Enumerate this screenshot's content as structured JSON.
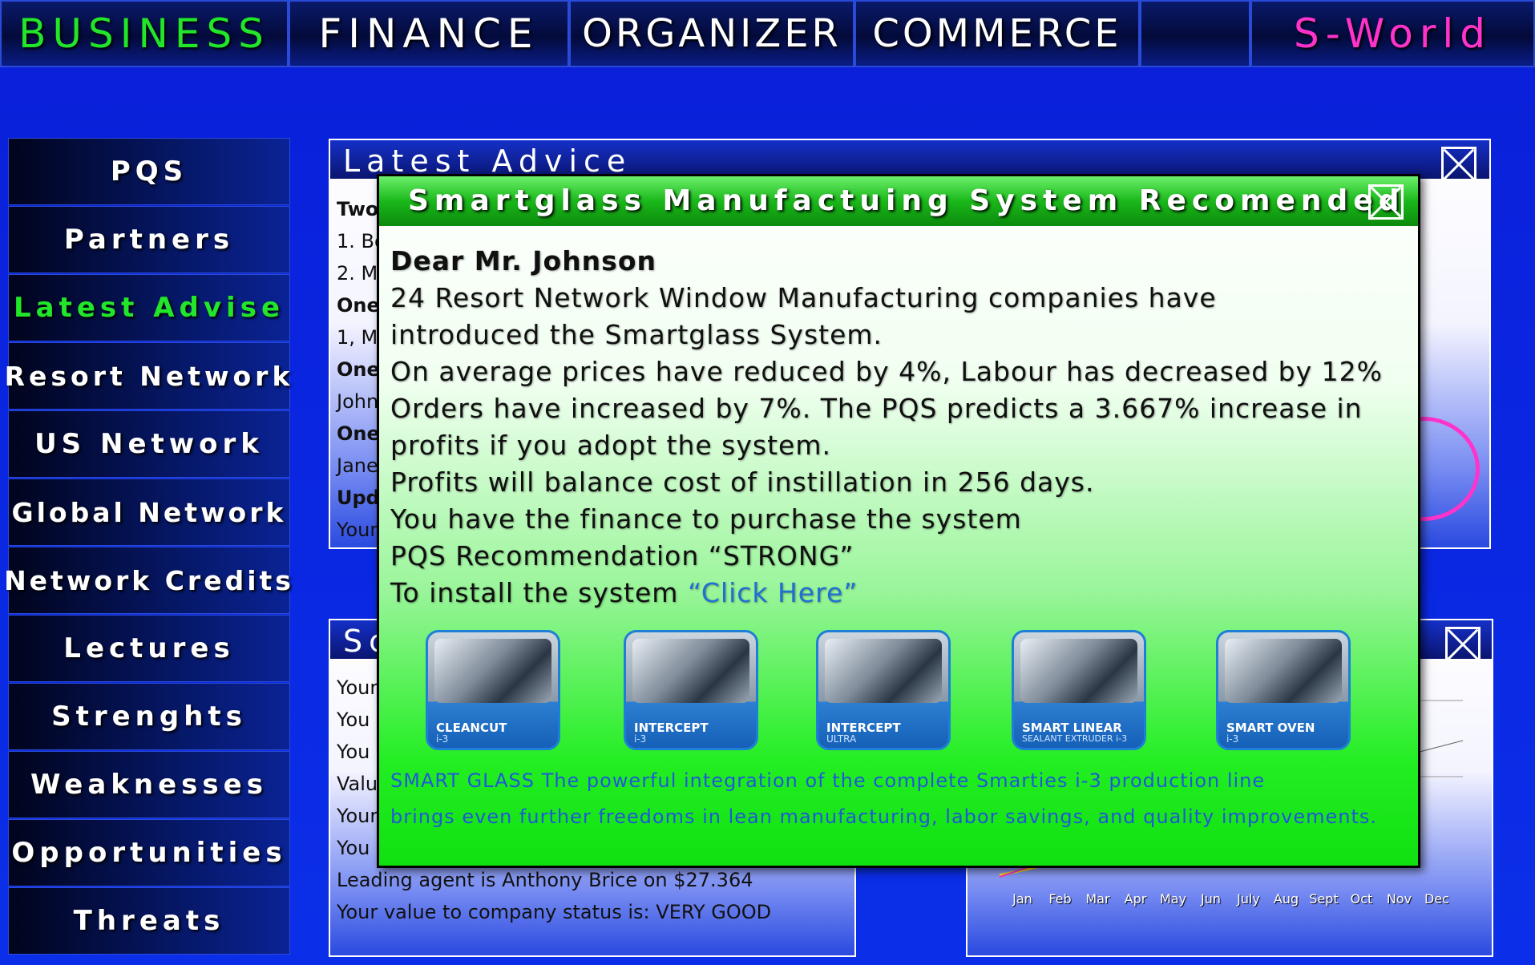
{
  "nav": {
    "tabs": [
      "BUSINESS",
      "FINANCE",
      "ORGANIZER",
      "COMMERCE",
      "",
      "S-World"
    ]
  },
  "sidebar": {
    "items": [
      "PQS",
      "Partners",
      "Latest Advise",
      "Resort Network",
      "US Network",
      "Global Network",
      "Network Credits",
      "Lectures",
      "Strenghts",
      "Weaknesses",
      "Opportunities",
      "Threats"
    ]
  },
  "advice_panel": {
    "title": "Latest Advice",
    "lines": [
      "Two",
      "1. Bo",
      "2. M",
      "One",
      "1, M",
      "One",
      "John",
      "One",
      "Jane",
      "Upd",
      "Your"
    ]
  },
  "score_panel": {
    "title": "Sc",
    "lines": [
      "Your",
      "You",
      "You",
      "Valu",
      "Your",
      "You",
      "Leading agent is Anthony Brice on $27.364",
      "Your value to company status is: VERY GOOD"
    ]
  },
  "chart_panel": {
    "months": [
      "Jan",
      "Feb",
      "Mar",
      "Apr",
      "May",
      "Jun",
      "July",
      "Aug",
      "Sept",
      "Oct",
      "Nov",
      "Dec"
    ]
  },
  "modal": {
    "title": "Smartglass Manufactuing System Recomended",
    "greeting": "Dear Mr. Johnson",
    "lines": [
      "24 Resort Network Window Manufacturing companies have",
      "introduced the Smartglass System.",
      "On average prices have reduced by 4%, Labour has decreased by 12%",
      "Orders have increased by 7%. The PQS predicts a 3.667% increase in",
      "profits if you adopt the system.",
      "Profits will balance cost of instillation in 256 days.",
      "You have the finance to purchase the system",
      "PQS Recommendation “STRONG”"
    ],
    "install_prefix": "To install the system ",
    "install_link": "“Click Here”",
    "products": [
      {
        "name": "CLEANCUT",
        "sub": "i-3"
      },
      {
        "name": "INTERCEPT",
        "sub": "i-3"
      },
      {
        "name": "INTERCEPT",
        "sub": "ULTRA"
      },
      {
        "name": "SMART LINEAR",
        "sub": "SEALANT EXTRUDER i-3"
      },
      {
        "name": "SMART OVEN",
        "sub": "i-3"
      }
    ],
    "description": [
      "SMART GLASS The powerful integration of the complete Smarties i-3 production line",
      "brings even further freedoms in lean manufacturing, labor savings, and quality improvements."
    ]
  }
}
